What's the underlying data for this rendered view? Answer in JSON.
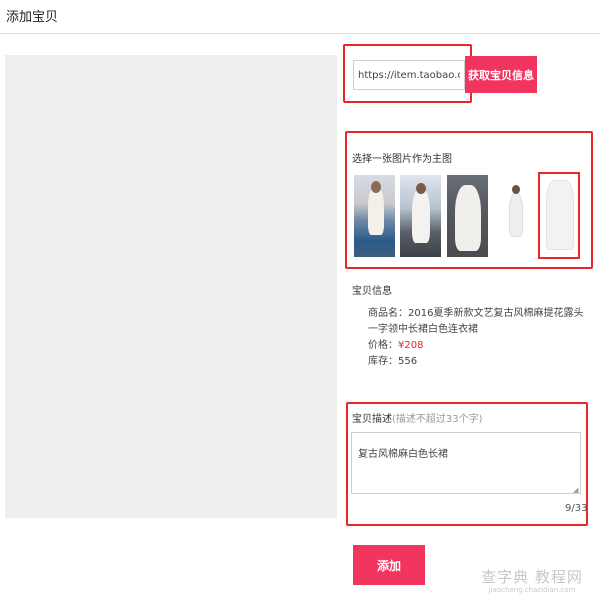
{
  "header": {
    "title": "添加宝贝"
  },
  "url": {
    "value": "https://item.taobao.com/item."
  },
  "fetch_button": {
    "label": "获取宝贝信息"
  },
  "choose_image": {
    "label": "选择一张图片作为主图"
  },
  "item_info": {
    "heading": "宝贝信息",
    "name_label": "商品名：",
    "name_value": "2016夏季新款文艺复古风棉麻提花露头一字领中长裙白色连衣裙",
    "price_label": "价格：",
    "price_value": "¥208",
    "stock_label": "库存：",
    "stock_value": "556"
  },
  "description": {
    "label": "宝贝描述",
    "hint": "(描述不超过33个字)",
    "value": "复古风棉麻白色长裙",
    "counter": "9/33"
  },
  "add_button": {
    "label": "添加"
  },
  "watermark": {
    "line1": "查字典 教程网",
    "line2": "jiaocheng.chazidian.com"
  },
  "colors": {
    "accent": "#f2355f",
    "highlight": "#e8262c",
    "price": "#e8262c"
  }
}
